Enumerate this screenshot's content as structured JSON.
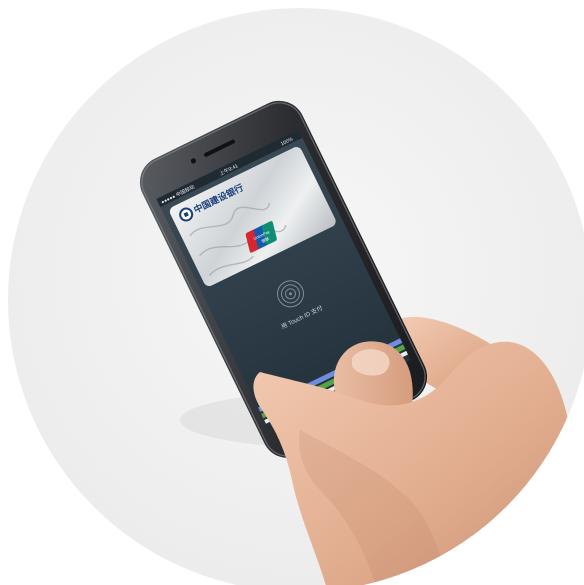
{
  "status_bar": {
    "carrier": "●●●●● 中国移动",
    "time": "上午9:41",
    "battery": "100%"
  },
  "card": {
    "bank_name": "中国建设银行",
    "network_label": "UnionPay",
    "network_sublabel": "银联"
  },
  "payment_prompt": {
    "text": "用 Touch ID 支付"
  },
  "colors": {
    "backdrop_circle": "#f2f2f2",
    "phone_body": "#2b2d31",
    "screen_background": "#2f3c46",
    "card_silver": "#d9dcdf",
    "unionpay_red": "#d7262f",
    "unionpay_blue": "#145aa8",
    "unionpay_green": "#0e8c74",
    "wallet_stripe_blue": "#6f8de0",
    "wallet_stripe_green": "#58a244",
    "skin": "#e7b79a"
  }
}
